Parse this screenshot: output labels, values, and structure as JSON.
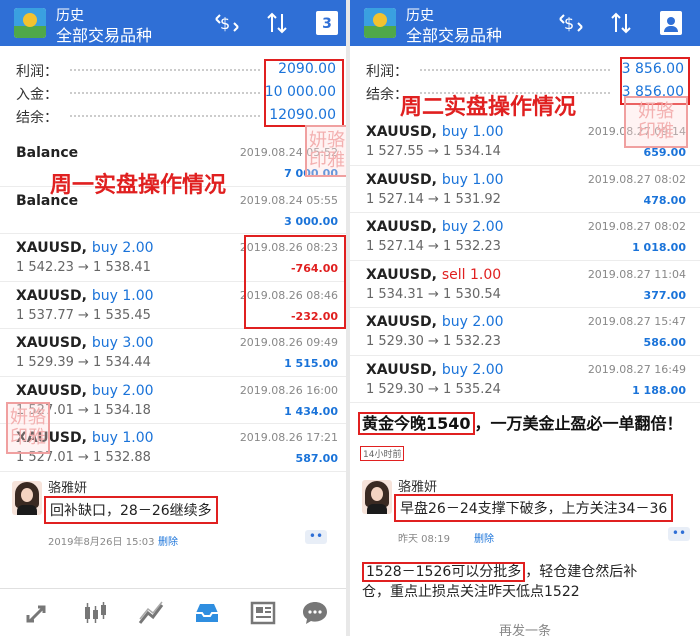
{
  "left": {
    "header": {
      "line1": "历史",
      "line2": "全部交易品种",
      "badge": "3"
    },
    "summary": {
      "profit_label": "利润：",
      "profit_value": "2090.00",
      "deposit_label": "入金：",
      "deposit_value": "10 000.00",
      "balance_label": "结余：",
      "balance_value": "12090.00"
    },
    "rows": [
      {
        "symbol": "Balance",
        "action": "",
        "action_type": "",
        "prices": "",
        "date": "2019.08.24 05:52",
        "profit": "7 000.00",
        "profit_type": "pos"
      },
      {
        "symbol": "Balance",
        "action": "",
        "action_type": "",
        "prices": "",
        "date": "2019.08.24 05:55",
        "profit": "3 000.00",
        "profit_type": "pos"
      },
      {
        "symbol": "XAUUSD,",
        "action": "buy 2.00",
        "action_type": "buy",
        "prices": "1 542.23 → 1 538.41",
        "date": "2019.08.26 08:23",
        "profit": "-764.00",
        "profit_type": "neg"
      },
      {
        "symbol": "XAUUSD,",
        "action": "buy 1.00",
        "action_type": "buy",
        "prices": "1 537.77 → 1 535.45",
        "date": "2019.08.26 08:46",
        "profit": "-232.00",
        "profit_type": "neg"
      },
      {
        "symbol": "XAUUSD,",
        "action": "buy 3.00",
        "action_type": "buy",
        "prices": "1 529.39 → 1 534.44",
        "date": "2019.08.26 09:49",
        "profit": "1 515.00",
        "profit_type": "pos"
      },
      {
        "symbol": "XAUUSD,",
        "action": "buy 2.00",
        "action_type": "buy",
        "prices": "1 527.01 → 1 534.18",
        "date": "2019.08.26 16:00",
        "profit": "1 434.00",
        "profit_type": "pos"
      },
      {
        "symbol": "XAUUSD,",
        "action": "buy 1.00",
        "action_type": "buy",
        "prices": "1 527.01 → 1 532.88",
        "date": "2019.08.26 17:21",
        "profit": "587.00",
        "profit_type": "pos"
      }
    ],
    "overlay_title": "周一实盘操作情况",
    "stamp_text": "妍骆 印雅",
    "comment": {
      "name": "骆雅妍",
      "text": "回补缺口，28－26继续多",
      "time": "2019年8月26日 15:03",
      "delete": "删除",
      "more": "••"
    },
    "nav_icons": [
      "trade-icon",
      "chart-candles-icon",
      "chart-line-icon",
      "inbox-icon",
      "news-icon",
      "chat-icon"
    ]
  },
  "right": {
    "header": {
      "line1": "历史",
      "line2": "全部交易品种"
    },
    "summary": {
      "profit_label": "利润：",
      "profit_value": "3 856.00",
      "balance_label": "结余：",
      "balance_value": "3 856.00"
    },
    "overlay_title": "周二实盘操作情况",
    "stamp_text": "妍骆 印雅",
    "rows": [
      {
        "symbol": "XAUUSD,",
        "action": "buy 1.00",
        "action_type": "buy",
        "prices": "1 527.55 → 1 534.14",
        "date": "2019.08.27 09:14",
        "profit": "659.00",
        "profit_type": "pos"
      },
      {
        "symbol": "XAUUSD,",
        "action": "buy 1.00",
        "action_type": "buy",
        "prices": "1 527.14 → 1 531.92",
        "date": "2019.08.27 08:02",
        "profit": "478.00",
        "profit_type": "pos"
      },
      {
        "symbol": "XAUUSD,",
        "action": "buy 2.00",
        "action_type": "buy",
        "prices": "1 527.14 → 1 532.23",
        "date": "2019.08.27 08:02",
        "profit": "1 018.00",
        "profit_type": "pos"
      },
      {
        "symbol": "XAUUSD,",
        "action": "sell 1.00",
        "action_type": "sell",
        "prices": "1 534.31 → 1 530.54",
        "date": "2019.08.27 11:04",
        "profit": "377.00",
        "profit_type": "pos"
      },
      {
        "symbol": "XAUUSD,",
        "action": "buy 2.00",
        "action_type": "buy",
        "prices": "1 529.30 → 1 532.23",
        "date": "2019.08.27 15:47",
        "profit": "586.00",
        "profit_type": "pos"
      },
      {
        "symbol": "XAUUSD,",
        "action": "buy 2.00",
        "action_type": "buy",
        "prices": "1 529.30 → 1 535.24",
        "date": "2019.08.27 16:49",
        "profit": "1 188.00",
        "profit_type": "pos"
      }
    ],
    "headline_boxed": "黄金今晚1540",
    "headline_rest": "，一万美金止盈必一单翻倍！",
    "headline_time": "14小时前",
    "comment": {
      "name": "骆雅妍",
      "text": "早盘26－24支撑下破多，上方关注34－36",
      "time": "昨天 08:19",
      "delete": "删除",
      "more": "••"
    },
    "note_boxed": "1528－1526可以分批多",
    "note_rest_1": "，轻仓建仓然后补",
    "note_rest_2": "仓，重点止损点关注昨天低点1522",
    "reply": "再发一条"
  }
}
